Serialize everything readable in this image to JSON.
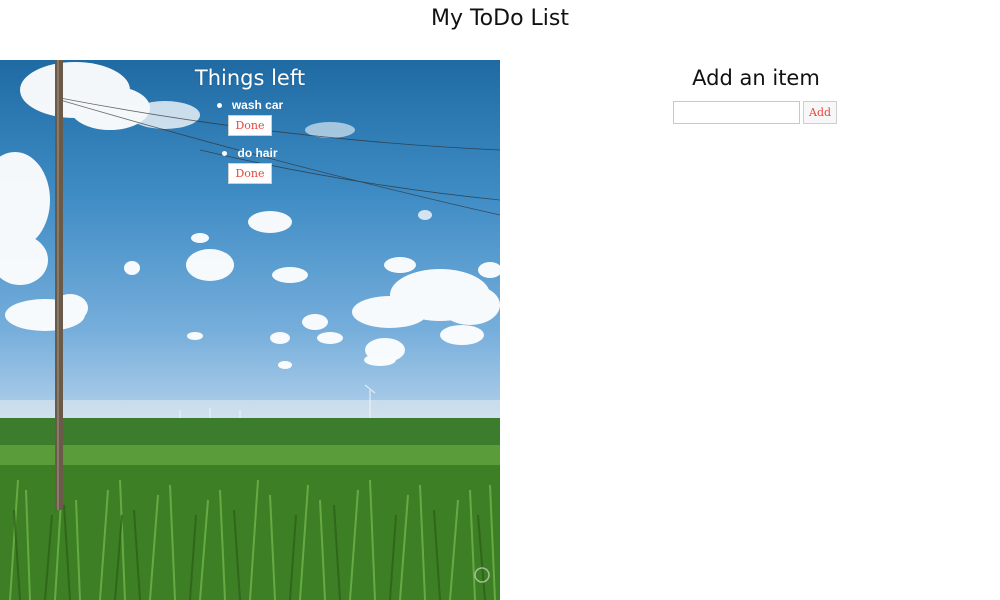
{
  "page": {
    "title": "My ToDo List"
  },
  "todo_panel": {
    "heading": "Things left",
    "items": [
      {
        "text": "wash car",
        "done_label": "Done"
      },
      {
        "text": "do hair",
        "done_label": "Done"
      }
    ]
  },
  "add_panel": {
    "heading": "Add an item",
    "input_value": "",
    "input_placeholder": "",
    "add_label": "Add"
  },
  "colors": {
    "button_text": "#e8453c",
    "sky_top": "#1f6aa3",
    "field_green": "#3f8a2c"
  }
}
